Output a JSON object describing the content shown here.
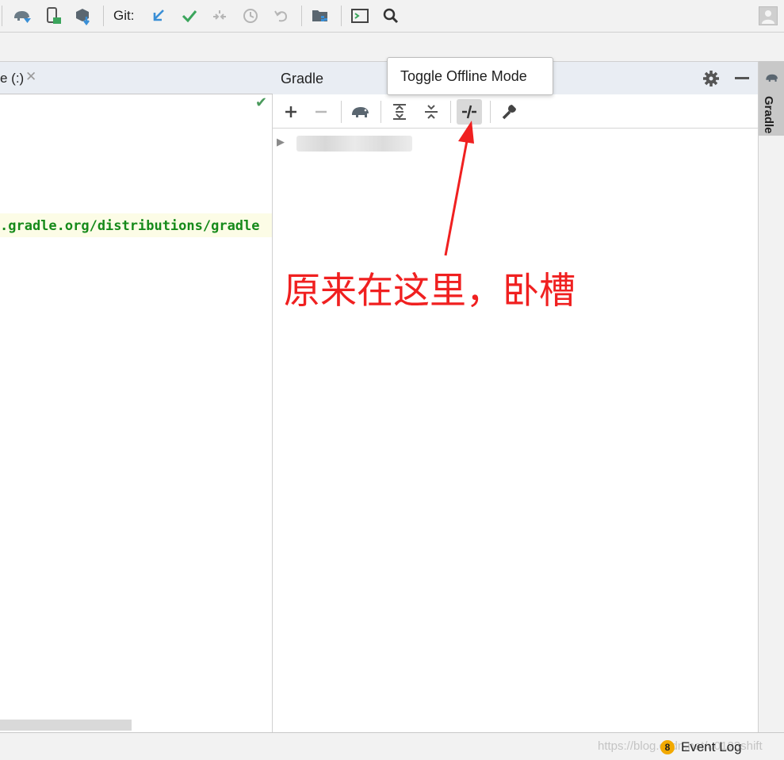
{
  "toolbar": {
    "git_label": "Git:",
    "icons": [
      "sync-gradle-icon",
      "device-manager-icon",
      "sdk-manager-icon",
      "git-update-icon",
      "git-commit-icon",
      "git-merge-icon",
      "git-history-icon",
      "git-revert-icon",
      "project-structure-icon",
      "terminal-icon",
      "search-icon",
      "user-avatar-icon"
    ]
  },
  "editor": {
    "tab_title": "e (:)",
    "tab_close": "✕",
    "code_line": ".gradle.org/distributions/gradle"
  },
  "gradle_panel": {
    "title": "Gradle",
    "tooltip": "Toggle Offline Mode",
    "toolbar_icons": [
      "add-icon",
      "remove-icon",
      "gradle-elephant-icon",
      "expand-all-icon",
      "collapse-all-icon",
      "toggle-offline-icon",
      "settings-wrench-icon"
    ]
  },
  "right_stripe": {
    "gradle_tab_label": "Gradle"
  },
  "annotation": {
    "text": "原来在这里，卧槽",
    "color": "#f02020"
  },
  "statusbar": {
    "event_badge": "8",
    "event_log_label": "Event Log",
    "watermark": "https://blog.csdn.net/u0123shift"
  },
  "colors": {
    "panel_header": "#e9edf3",
    "code_highlight": "#fcfce6",
    "code_text": "#168a1a",
    "accent_blue": "#3a8fd6",
    "accent_green": "#3ba55c"
  }
}
